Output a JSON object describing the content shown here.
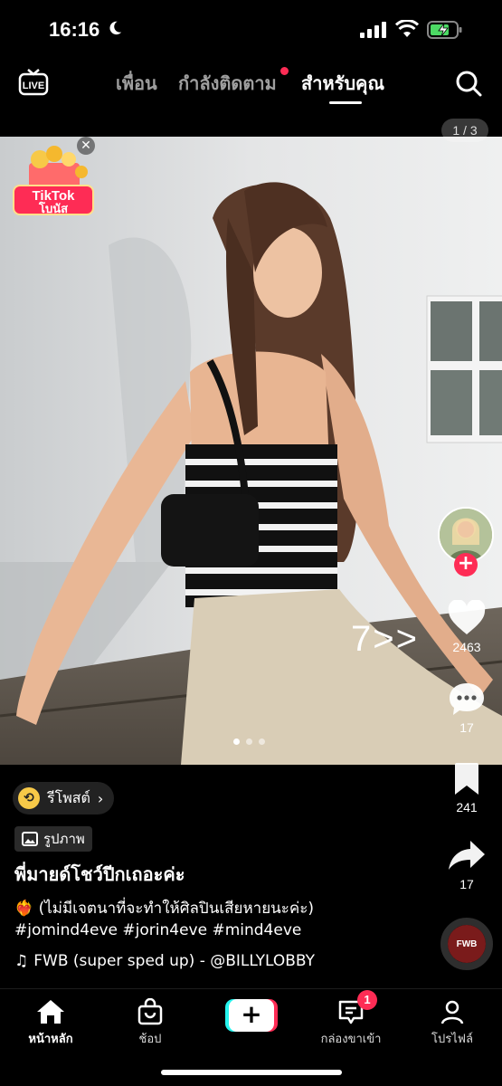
{
  "status_bar": {
    "time": "16:16"
  },
  "top_nav": {
    "live_label": "LIVE",
    "tabs": [
      {
        "label": "เพื่อน"
      },
      {
        "label": "กำลังติดตาม"
      },
      {
        "label": "สำหรับคุณ"
      }
    ],
    "active_tab": "สำหรับคุณ"
  },
  "post": {
    "page_counter": "1 / 3",
    "image_index": 1,
    "image_count": 3,
    "bonus": {
      "line1": "TikTok",
      "line2": "โบนัส"
    },
    "overlay_text": "7>>",
    "repost_label": "รีโพสต์",
    "media_badge": "รูปภาพ",
    "title": "พี่มายด์โชว์ปีกเถอะค่ะ",
    "description_line1": "❤️‍🔥 (ไม่มีเจตนาที่จะทำให้ศิลปินเสียหายนะค่ะ)",
    "description_line2": "#jomind4eve #jorin4eve  #mind4eve",
    "music": "FWB (super sped up) - @BILLYLOBBY",
    "music_disc_label": "FWB"
  },
  "actions": {
    "likes": "2463",
    "comments": "17",
    "saves": "241",
    "shares": "17"
  },
  "bottom_nav": {
    "home": "หน้าหลัก",
    "shop": "ช้อป",
    "create": "+",
    "inbox": "กล่องขาเข้า",
    "inbox_badge": "1",
    "profile": "โปรไฟล์"
  },
  "colors": {
    "accent": "#fe2c55",
    "cyan": "#25f4ee",
    "battery": "#4cd964"
  }
}
